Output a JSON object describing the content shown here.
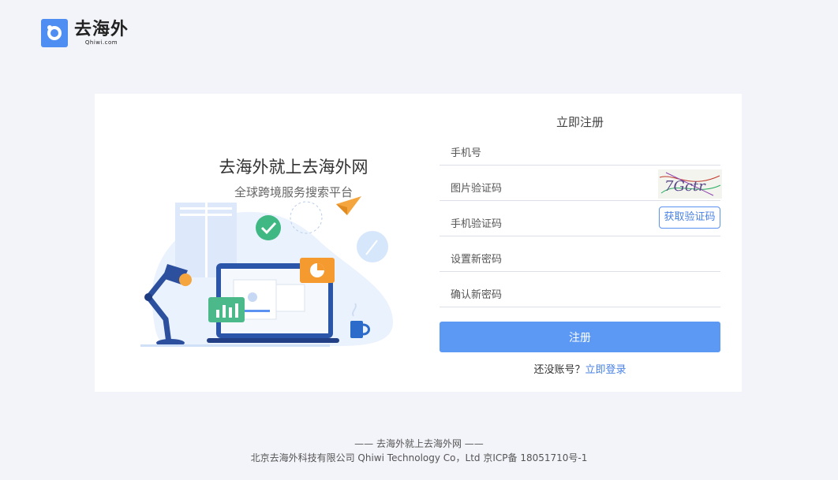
{
  "brand": {
    "logo_text": "去海外",
    "logo_sub": "Qhiwi.com"
  },
  "hero": {
    "title": "去海外就上去海外网",
    "subtitle": "全球跨境服务搜索平台"
  },
  "form": {
    "title": "立即注册",
    "phone_placeholder": "手机号",
    "captcha_placeholder": "图片验证码",
    "captcha_text": "7Gctr",
    "sms_placeholder": "手机验证码",
    "sms_button": "获取验证码",
    "password_placeholder": "设置新密码",
    "confirm_placeholder": "确认新密码",
    "submit": "注册",
    "no_account": "还没账号？",
    "login_link": "立即登录"
  },
  "footer": {
    "slogan": "—— 去海外就上去海外网 ——",
    "company": "北京去海外科技有限公司 Qhiwi Technology Co，Ltd 京ICP备 18051710号-1"
  },
  "colors": {
    "primary": "#5b99f5",
    "link": "#4a82e6",
    "background": "#f3f4f9"
  }
}
